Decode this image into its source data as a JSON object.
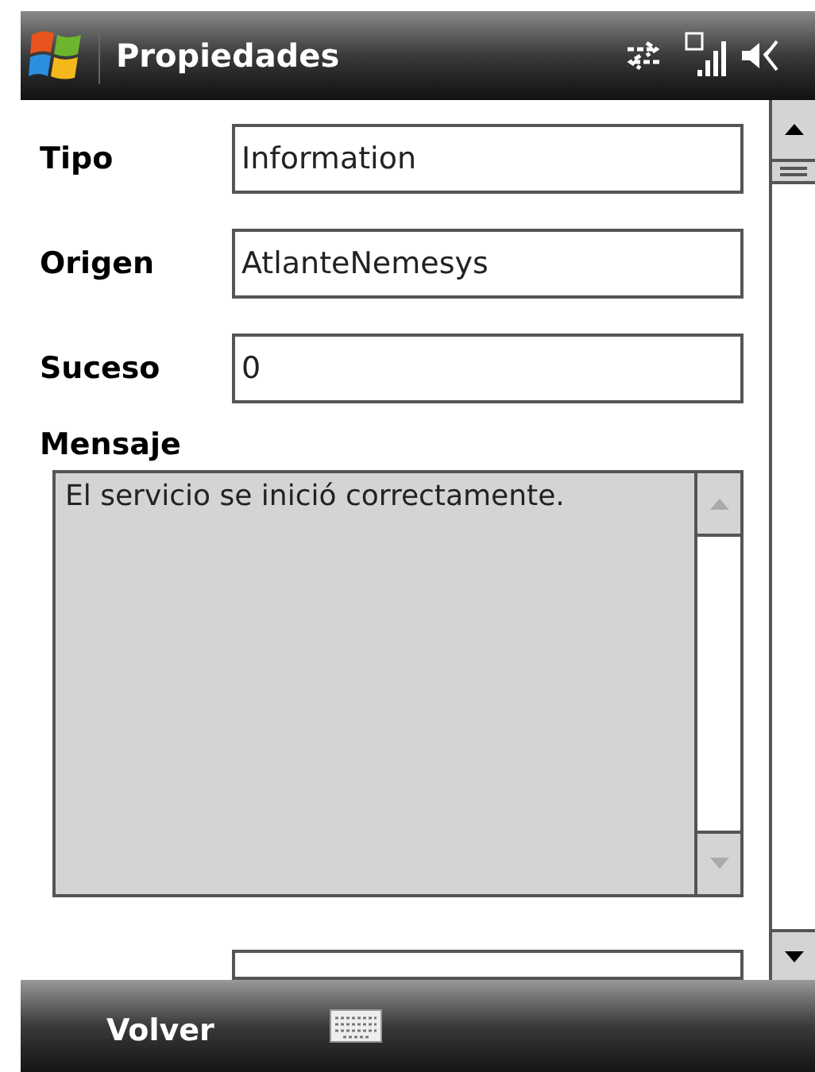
{
  "title_bar": {
    "title": "Propiedades"
  },
  "fields": [
    {
      "label": "Tipo",
      "value": "Information"
    },
    {
      "label": "Origen",
      "value": "AtlanteNemesys"
    },
    {
      "label": "Suceso",
      "value": "0"
    }
  ],
  "message": {
    "label": "Mensaje",
    "value": "El servicio se inició correctamente.",
    "disabled": true
  },
  "soft_keys": {
    "left": "Volver"
  }
}
